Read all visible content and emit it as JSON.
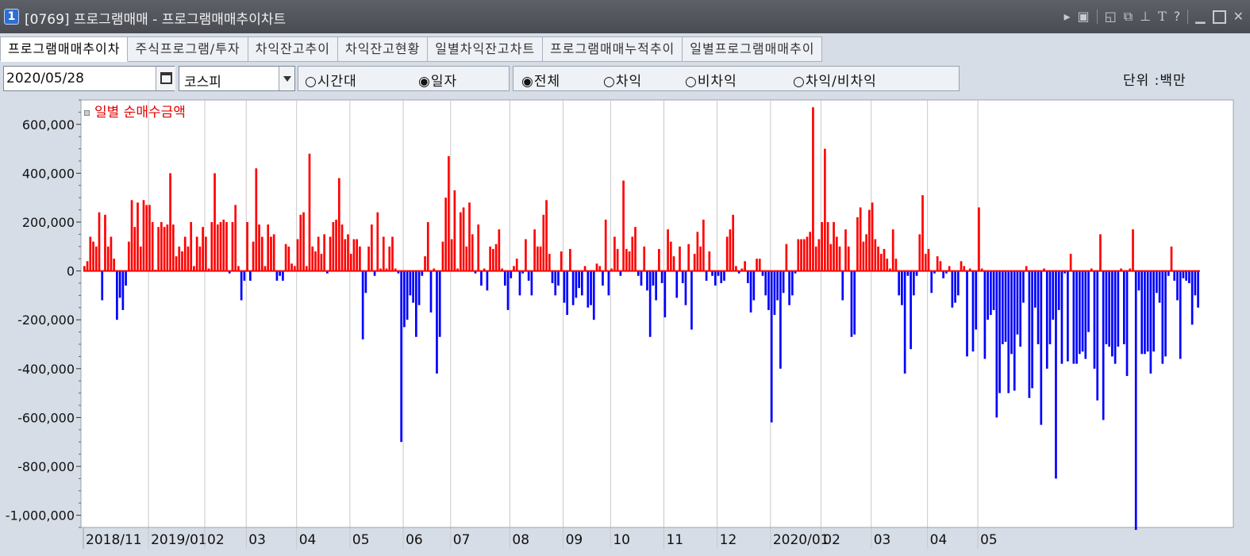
{
  "window": {
    "number": "1",
    "title": "[0769] 프로그램매매 - 프로그램매매추이차트"
  },
  "tabs": [
    {
      "label": "프로그램매매추이차",
      "active": true
    },
    {
      "label": "주식프로그램/투자",
      "active": false
    },
    {
      "label": "차익잔고추이",
      "active": false
    },
    {
      "label": "차익잔고현황",
      "active": false
    },
    {
      "label": "일별차익잔고차트",
      "active": false
    },
    {
      "label": "프로그램매매누적추이",
      "active": false
    },
    {
      "label": "일별프로그램매매추이",
      "active": false
    }
  ],
  "toolbar": {
    "date": "2020/05/28",
    "market": "코스피",
    "period_options": [
      {
        "label": "○시간대",
        "selected": false
      },
      {
        "label": "◉일자",
        "selected": true
      }
    ],
    "type_options": [
      {
        "label": "◉전체",
        "selected": true
      },
      {
        "label": "○차익",
        "selected": false
      },
      {
        "label": "○비차익",
        "selected": false
      },
      {
        "label": "○차익/비차익",
        "selected": false
      }
    ],
    "unit": "단위 :백만"
  },
  "colors": {
    "positive": "#ff0000",
    "negative": "#0000ff",
    "axis_bg": "#d6dde6",
    "plot_bg": "#ffffff",
    "grid": "#c8c8c8"
  },
  "chart_data": {
    "type": "bar",
    "title": "",
    "legend": [
      "일별 순매수금액"
    ],
    "legend_position": "top-left",
    "xlabel": "",
    "ylabel": "",
    "ylim": [
      -1050000,
      700000
    ],
    "y_ticks": [
      600000,
      400000,
      200000,
      0,
      -200000,
      -400000,
      -600000,
      -800000,
      -1000000
    ],
    "y_tick_labels": [
      "600,000",
      "400,000",
      "200,000",
      "0",
      "-200,000",
      "-400,000",
      "-600,000",
      "-800,000",
      "-1,000,000"
    ],
    "x_ticks": [
      {
        "label": "2018/11",
        "index": 0
      },
      {
        "label": "2019/01",
        "index": 22
      },
      {
        "label": "02",
        "index": 41
      },
      {
        "label": "03",
        "index": 55
      },
      {
        "label": "04",
        "index": 72
      },
      {
        "label": "05",
        "index": 90
      },
      {
        "label": "06",
        "index": 108
      },
      {
        "label": "07",
        "index": 124
      },
      {
        "label": "08",
        "index": 144
      },
      {
        "label": "09",
        "index": 162
      },
      {
        "label": "10",
        "index": 178
      },
      {
        "label": "11",
        "index": 196
      },
      {
        "label": "12",
        "index": 214
      },
      {
        "label": "2020/01",
        "index": 232
      },
      {
        "label": "02",
        "index": 249
      },
      {
        "label": "03",
        "index": 266
      },
      {
        "label": "04",
        "index": 285
      },
      {
        "label": "05",
        "index": 302
      }
    ],
    "grid": true,
    "series": [
      {
        "name": "일별 순매수금액",
        "values": [
          20000,
          40000,
          140000,
          120000,
          100000,
          240000,
          -120000,
          230000,
          100000,
          140000,
          50000,
          -200000,
          -110000,
          -160000,
          -60000,
          120000,
          290000,
          180000,
          280000,
          100000,
          290000,
          270000,
          270000,
          200000,
          5000,
          180000,
          200000,
          180000,
          190000,
          400000,
          190000,
          60000,
          100000,
          80000,
          140000,
          100000,
          200000,
          20000,
          140000,
          100000,
          180000,
          140000,
          10000,
          200000,
          400000,
          190000,
          200000,
          210000,
          200000,
          -10000,
          200000,
          270000,
          20000,
          -120000,
          -40000,
          200000,
          -40000,
          120000,
          420000,
          190000,
          140000,
          20000,
          190000,
          140000,
          150000,
          -40000,
          -20000,
          -40000,
          110000,
          100000,
          30000,
          20000,
          130000,
          230000,
          240000,
          20000,
          480000,
          100000,
          80000,
          140000,
          70000,
          150000,
          -10000,
          140000,
          200000,
          210000,
          380000,
          190000,
          130000,
          150000,
          70000,
          130000,
          130000,
          100000,
          -280000,
          -90000,
          100000,
          190000,
          -20000,
          240000,
          10000,
          140000,
          10000,
          100000,
          140000,
          10000,
          -10000,
          -700000,
          -230000,
          -200000,
          -100000,
          -130000,
          -270000,
          -140000,
          -20000,
          60000,
          200000,
          -170000,
          10000,
          -420000,
          -270000,
          120000,
          300000,
          470000,
          130000,
          330000,
          10000,
          240000,
          260000,
          100000,
          280000,
          150000,
          -10000,
          190000,
          -60000,
          10000,
          -80000,
          100000,
          90000,
          110000,
          170000,
          10000,
          -60000,
          -160000,
          -30000,
          20000,
          50000,
          -100000,
          -10000,
          130000,
          -40000,
          -100000,
          170000,
          100000,
          100000,
          230000,
          290000,
          70000,
          -50000,
          -100000,
          -60000,
          80000,
          -130000,
          -180000,
          90000,
          -140000,
          -110000,
          -70000,
          -100000,
          20000,
          -150000,
          -140000,
          -200000,
          30000,
          20000,
          -60000,
          210000,
          -100000,
          10000,
          140000,
          90000,
          -20000,
          370000,
          90000,
          80000,
          140000,
          180000,
          -20000,
          -60000,
          100000,
          -80000,
          -270000,
          -60000,
          -120000,
          90000,
          -50000,
          -190000,
          170000,
          120000,
          60000,
          -110000,
          100000,
          -50000,
          -140000,
          110000,
          -240000,
          70000,
          160000,
          100000,
          210000,
          -40000,
          80000,
          -20000,
          -60000,
          -20000,
          -50000,
          -40000,
          140000,
          170000,
          230000,
          20000,
          -10000,
          10000,
          40000,
          -50000,
          -170000,
          -120000,
          50000,
          50000,
          -20000,
          -100000,
          -160000,
          -620000,
          -180000,
          -120000,
          -400000,
          -90000,
          110000,
          -140000,
          -100000,
          -10000,
          130000,
          130000,
          130000,
          140000,
          160000,
          670000,
          100000,
          130000,
          200000,
          500000,
          200000,
          110000,
          200000,
          140000,
          100000,
          -120000,
          170000,
          100000,
          -270000,
          -260000,
          220000,
          260000,
          120000,
          150000,
          250000,
          280000,
          130000,
          100000,
          70000,
          90000,
          50000,
          10000,
          170000,
          50000,
          -100000,
          -140000,
          -420000,
          -20000,
          -320000,
          -100000,
          -20000,
          150000,
          310000,
          70000,
          90000,
          -90000,
          -10000,
          60000,
          40000,
          -30000,
          -10000,
          20000,
          -150000,
          -130000,
          -100000,
          40000,
          20000,
          -350000,
          10000,
          -330000,
          -240000,
          260000,
          10000,
          -360000,
          -200000,
          -180000,
          -160000,
          -600000,
          -500000,
          -300000,
          -290000,
          -500000,
          -340000,
          -490000,
          -260000,
          -310000,
          -130000,
          20000,
          -520000,
          -480000,
          -150000,
          -300000,
          -630000,
          10000,
          -400000,
          -300000,
          -200000,
          -850000,
          -160000,
          -380000,
          -10000,
          -370000,
          70000,
          -380000,
          -380000,
          -340000,
          -330000,
          -360000,
          -250000,
          10000,
          -400000,
          -530000,
          150000,
          -610000,
          -300000,
          -310000,
          -350000,
          -380000,
          -310000,
          10000,
          -300000,
          -430000,
          10000,
          170000,
          -1060000,
          -80000,
          -340000,
          -340000,
          -330000,
          -420000,
          -330000,
          -90000,
          -130000,
          -380000,
          -350000,
          -20000,
          100000,
          -40000,
          -120000,
          -360000,
          -30000,
          -40000,
          -50000,
          -220000,
          -100000,
          -150000
        ]
      }
    ]
  }
}
